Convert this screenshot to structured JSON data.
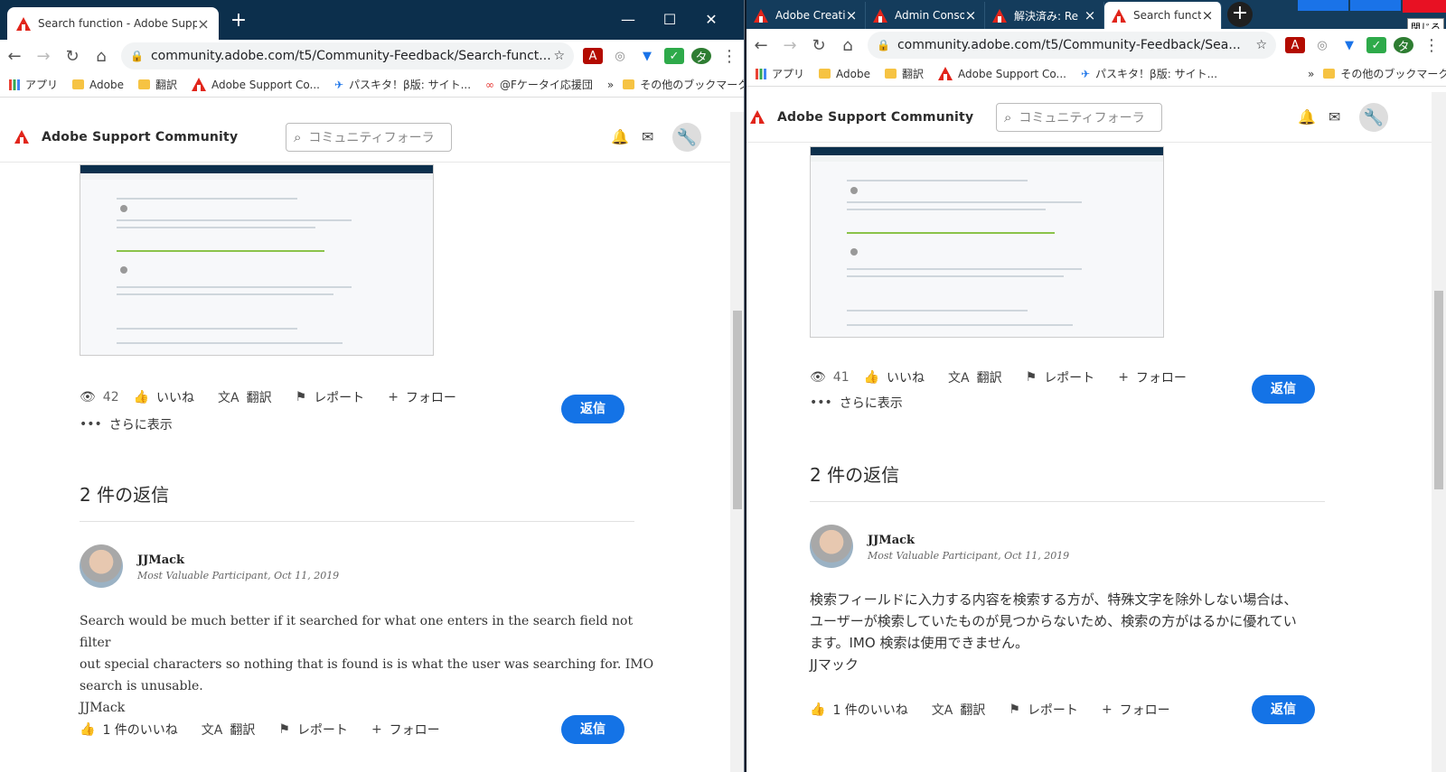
{
  "left": {
    "tab_title": "Search function - Adobe Support",
    "url": "community.adobe.com/t5/Community-Feedback/Search-funct...",
    "bookmarks": [
      "アプリ",
      "Adobe",
      "翻訳",
      "Adobe Support Co...",
      "パスキタ！β版: サイト...",
      "@Fケータイ応援団",
      "その他のブックマーク"
    ],
    "site_name": "Adobe Support Community",
    "search_placeholder": "コミュニティフォーラ",
    "views": "42",
    "actions": {
      "like": "いいね",
      "translate": "翻訳",
      "report": "レポート",
      "follow": "フォロー",
      "more": "さらに表示"
    },
    "reply": "返信",
    "replies_heading": "2 件の返信",
    "author": "JJMack",
    "role": "Most Valuable Participant, Oct 11, 2019",
    "body_lines": [
      "Search would be much better if it searched for what one enters in the search field not filter",
      "out special characters so nothing  that is found is  is what the user was searching for. IMO",
      "search is unusable.",
      "JJMack"
    ],
    "like_count": "1 件のいいね"
  },
  "right": {
    "tabs": [
      "Adobe Creati",
      "Admin Conso",
      "解決済み: Re",
      "Search functi"
    ],
    "url": "community.adobe.com/t5/Community-Feedback/Sea...",
    "bookmarks": [
      "アプリ",
      "Adobe",
      "翻訳",
      "Adobe Support Co...",
      "パスキタ！β版: サイト...",
      "その他のブックマーク"
    ],
    "site_name": "Adobe Support Community",
    "search_placeholder": "コミュニティフォーラ",
    "views": "41",
    "actions": {
      "like": "いいね",
      "translate": "翻訳",
      "report": "レポート",
      "follow": "フォロー",
      "more": "さらに表示"
    },
    "reply": "返信",
    "replies_heading": "2 件の返信",
    "author": "JJMack",
    "role": "Most Valuable Participant, Oct 11, 2019",
    "body_lines": [
      "検索フィールドに入力する内容を検索する方が、特殊文字を除外しない場合は、",
      "ユーザーが検索していたものが見つからないため、検索の方がはるかに優れてい",
      "ます。IMO 検索は使用できません。",
      "JJマック"
    ],
    "like_count": "1 件のいいね",
    "close_tooltip": "閉じる"
  }
}
